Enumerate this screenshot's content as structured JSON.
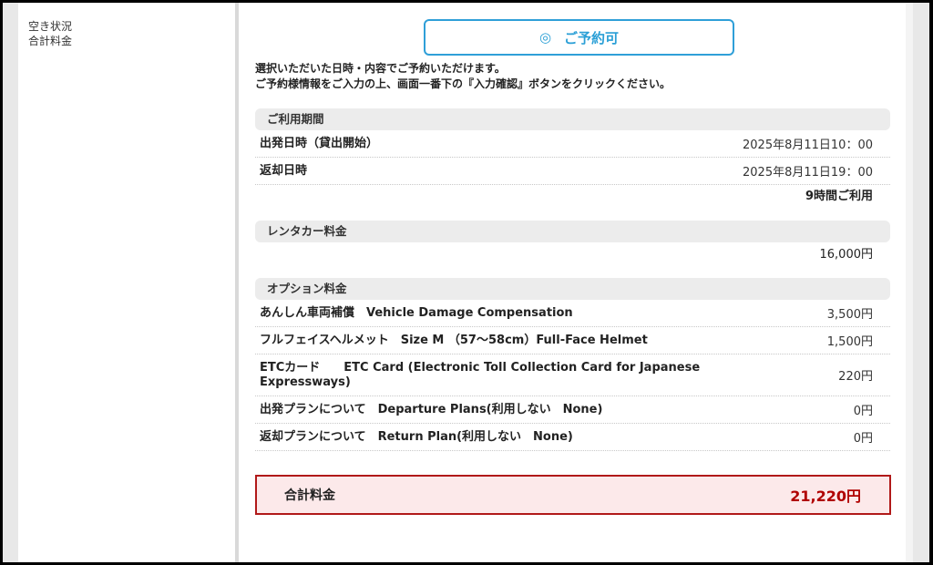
{
  "sidebar": {
    "labels": [
      "空き状況",
      "合計料金"
    ]
  },
  "status": {
    "icon": "◎",
    "label": "ご予約可"
  },
  "notice": [
    "選択いただいた日時・内容でご予約いただけます。",
    "ご予約様情報をご入力の上、画面一番下の『入力確認』ボタンをクリックください。"
  ],
  "period": {
    "heading": "ご利用期間",
    "departure_label": "出発日時（貸出開始）",
    "departure_value": "2025年8月11日10：00",
    "return_label": "返却日時",
    "return_value": "2025年8月11日19：00",
    "duration": "9時間ご利用"
  },
  "rental": {
    "heading": "レンタカー料金",
    "amount": "16,000円"
  },
  "options": {
    "heading": "オプション料金",
    "items": [
      {
        "label": "あんしん車両補償　Vehicle Damage Compensation",
        "amount": "3,500円"
      },
      {
        "label": "フルフェイスヘルメット　Size M （57〜58cm）Full-Face Helmet",
        "amount": "1,500円"
      },
      {
        "label": "ETCカード　　ETC Card (Electronic Toll Collection Card for Japanese Expressways)",
        "amount": "220円"
      },
      {
        "label": "出発プランについて　Departure Plans(利用しない　None)",
        "amount": "0円"
      },
      {
        "label": "返却プランについて　Return Plan(利用しない　None)",
        "amount": "0円"
      }
    ]
  },
  "total": {
    "label": "合計料金",
    "amount": "21,220円"
  },
  "colors": {
    "accent": "#2a9fd6",
    "total_border": "#b11919",
    "total_bg": "#fce9ea",
    "total_amount": "#b00000"
  }
}
